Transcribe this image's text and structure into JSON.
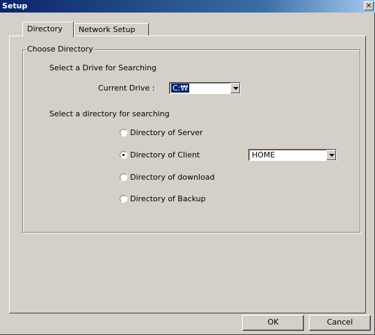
{
  "window": {
    "title": "Setup",
    "close_symbol": "×",
    "close_icon": "close-icon"
  },
  "tabs": [
    {
      "label": "Directory",
      "active": true
    },
    {
      "label": "Network Setup",
      "active": false
    }
  ],
  "group": {
    "legend": "Choose Directory",
    "drive_section_label": "Select a Drive for Searching",
    "current_drive_label": "Current Drive :",
    "current_drive_value": "C:₩",
    "directory_section_label": "Select a directory for searching",
    "radios": [
      {
        "label": "Directory of Server",
        "checked": false
      },
      {
        "label": "Directory of Client",
        "checked": true
      },
      {
        "label": "Directory of download",
        "checked": false
      },
      {
        "label": "Directory of Backup",
        "checked": false
      }
    ],
    "client_dir_value": "HOME"
  },
  "buttons": {
    "ok": "OK",
    "cancel": "Cancel"
  },
  "colors": {
    "title_bar": "#0a246a",
    "face": "#d4d0c8",
    "selection": "#0a246a"
  }
}
